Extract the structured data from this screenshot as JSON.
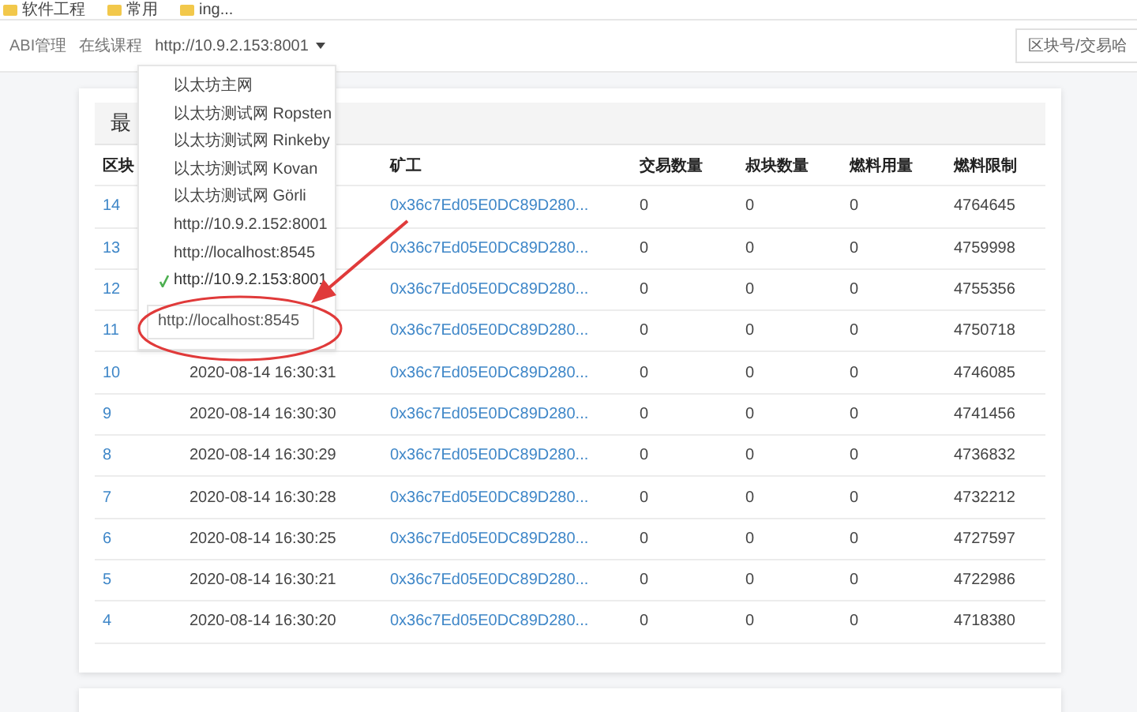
{
  "bookmarks": [
    {
      "label": "软件工程"
    },
    {
      "label": "常用"
    },
    {
      "label": "ing..."
    }
  ],
  "nav": {
    "links": [
      {
        "label": "ABI管理"
      },
      {
        "label": "在线课程"
      }
    ],
    "network": "http://10.9.2.153:8001",
    "search": {
      "placeholder": "区块号/交易哈"
    }
  },
  "card": {
    "title": "最",
    "columns": [
      "区块",
      "",
      "矿工",
      "交易数量",
      "叔块数量",
      "燃料用量",
      "燃料限制"
    ],
    "rows": [
      {
        "number": "14",
        "miner": "0x36c7Ed05E0DC89D280...",
        "txs": "0",
        "uncles": "0",
        "gas_used": "0",
        "gas_limit": "4764645"
      },
      {
        "number": "13",
        "miner": "0x36c7Ed05E0DC89D280...",
        "txs": "0",
        "uncles": "0",
        "gas_used": "0",
        "gas_limit": "4759998"
      },
      {
        "number": "12",
        "miner": "0x36c7Ed05E0DC89D280...",
        "txs": "0",
        "uncles": "0",
        "gas_used": "0",
        "gas_limit": "4755356"
      },
      {
        "number": "11",
        "miner": "0x36c7Ed05E0DC89D280...",
        "txs": "0",
        "uncles": "0",
        "gas_used": "0",
        "gas_limit": "4750718"
      },
      {
        "number": "10",
        "time": "2020-08-14 16:30:31",
        "miner": "0x36c7Ed05E0DC89D280...",
        "txs": "0",
        "uncles": "0",
        "gas_used": "0",
        "gas_limit": "4746085"
      },
      {
        "number": "9",
        "time": "2020-08-14 16:30:30",
        "miner": "0x36c7Ed05E0DC89D280...",
        "txs": "0",
        "uncles": "0",
        "gas_used": "0",
        "gas_limit": "4741456"
      },
      {
        "number": "8",
        "time": "2020-08-14 16:30:29",
        "miner": "0x36c7Ed05E0DC89D280...",
        "txs": "0",
        "uncles": "0",
        "gas_used": "0",
        "gas_limit": "4736832"
      },
      {
        "number": "7",
        "time": "2020-08-14 16:30:28",
        "miner": "0x36c7Ed05E0DC89D280...",
        "txs": "0",
        "uncles": "0",
        "gas_used": "0",
        "gas_limit": "4732212"
      },
      {
        "number": "6",
        "time": "2020-08-14 16:30:25",
        "miner": "0x36c7Ed05E0DC89D280...",
        "txs": "0",
        "uncles": "0",
        "gas_used": "0",
        "gas_limit": "4727597"
      },
      {
        "number": "5",
        "time": "2020-08-14 16:30:21",
        "miner": "0x36c7Ed05E0DC89D280...",
        "txs": "0",
        "uncles": "0",
        "gas_used": "0",
        "gas_limit": "4722986"
      },
      {
        "number": "4",
        "time": "2020-08-14 16:30:20",
        "miner": "0x36c7Ed05E0DC89D280...",
        "txs": "0",
        "uncles": "0",
        "gas_used": "0",
        "gas_limit": "4718380"
      }
    ]
  },
  "network_menu": {
    "items": [
      {
        "label": "以太坊主网",
        "selected": false
      },
      {
        "label": "以太坊测试网 Ropsten",
        "selected": false
      },
      {
        "label": "以太坊测试网 Rinkeby",
        "selected": false
      },
      {
        "label": "以太坊测试网 Kovan",
        "selected": false
      },
      {
        "label": "以太坊测试网 Görli",
        "selected": false
      },
      {
        "label": "http://10.9.2.152:8001",
        "selected": false
      },
      {
        "label": "http://localhost:8545",
        "selected": false
      },
      {
        "label": "http://10.9.2.153:8001",
        "selected": true
      }
    ],
    "custom_input": {
      "value": "http://localhost:8545"
    }
  }
}
